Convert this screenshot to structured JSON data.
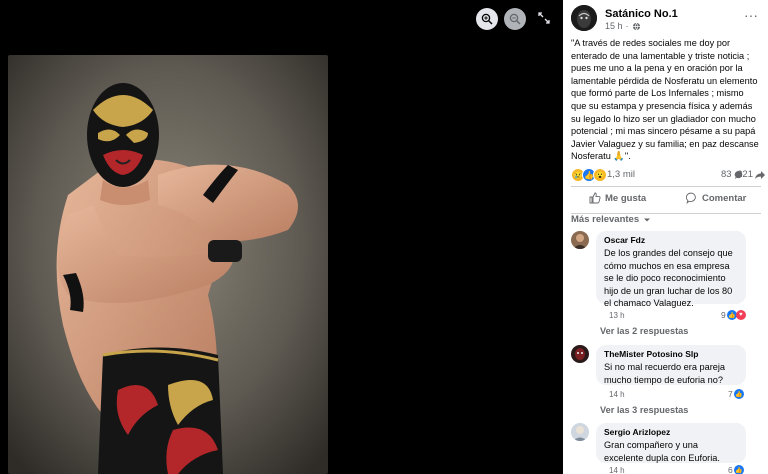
{
  "viewer": {
    "zoom_in_icon": "zoom-in-icon",
    "zoom_out_icon": "zoom-out-icon",
    "expand_icon": "expand-icon"
  },
  "post": {
    "page_name": "Satánico No.1",
    "time": "15 h",
    "audience_icon": "globe-icon",
    "text": "\"A través de redes sociales me doy por enterado de una lamentable y triste noticia ; pues me uno a la pena y en oración por la lamentable pérdida de Nosferatu un elemento que formó parte de Los Infernales ; mismo que su estampa y presencia física y además su legado lo hizo ser un gladiador con mucho potencial ; mi mas sincero pésame a su papá Javier Valaguez y su familia; en paz descanse Nosferatu 🙏\".",
    "reaction_count": "1,3 mil",
    "comment_count": "83",
    "share_count": "221"
  },
  "actions": {
    "like_label": "Me gusta",
    "comment_label": "Comentar"
  },
  "sort_label": "Más relevantes",
  "comments": [
    {
      "author": "Oscar Fdz",
      "text": "De los grandes del consejo que cómo muchos en esa empresa se le dio poco reconocimiento hijo de un gran luchar de los 80 el chamaco Valaguez.",
      "time": "13 h",
      "reactions": "9",
      "replies": "Ver las 2 respuestas"
    },
    {
      "author": "TheMister Potosino Slp",
      "text": "Si no mal recuerdo era pareja mucho tiempo de euforia no?",
      "time": "14 h",
      "reactions": "7",
      "replies": "Ver las 3 respuestas"
    },
    {
      "author": "Sergio Arizlopez",
      "text": "Gran compañero y una excelente dupla con Euforia.",
      "time": "14 h",
      "reactions": "6"
    }
  ],
  "colors": {
    "accent": "#1877f2",
    "love": "#f33e58",
    "secondary_text": "#65676b",
    "bubble": "#f0f2f5"
  }
}
